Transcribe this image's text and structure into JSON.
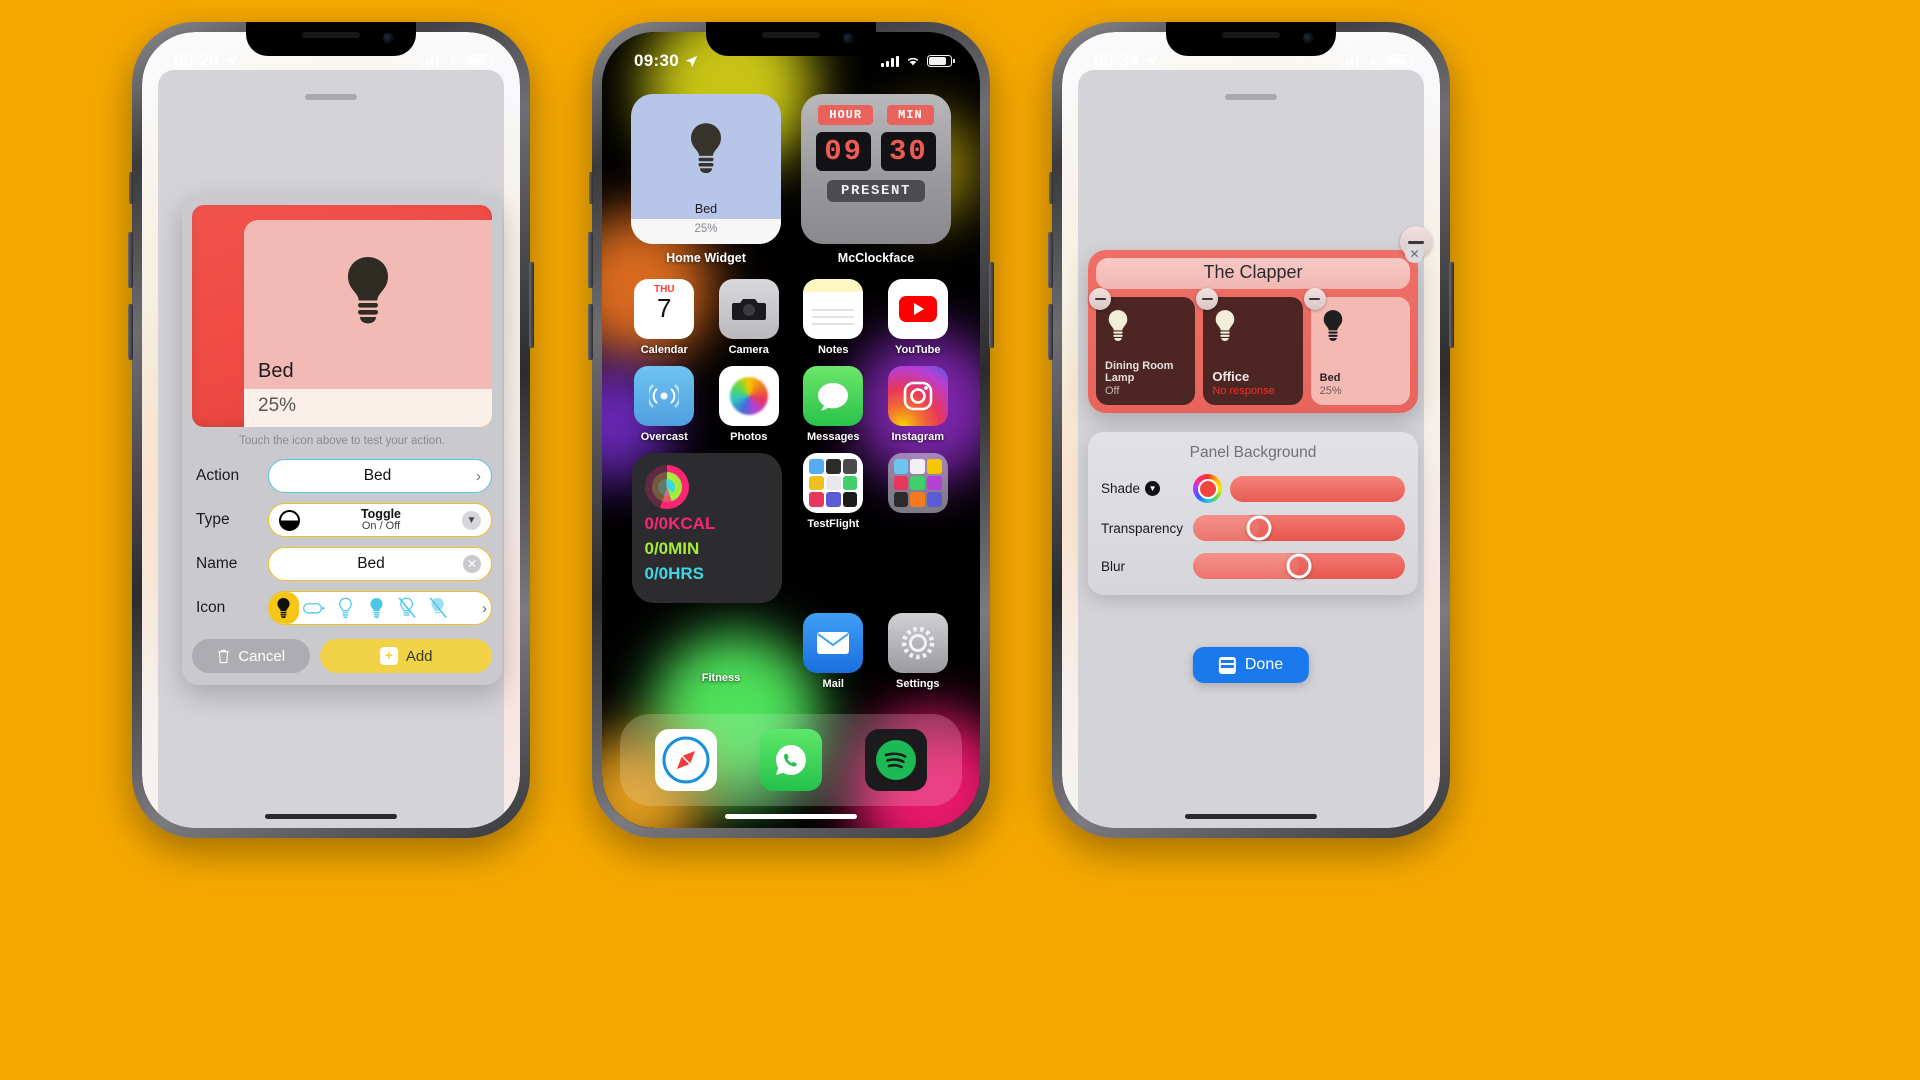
{
  "background_color": "#F5A800",
  "phones": {
    "phone1": {
      "status": {
        "time": "09:26",
        "location_icon": "location-arrow-icon"
      },
      "modal": {
        "preview": {
          "name": "Bed",
          "value": "25%",
          "icon": "lightbulb-icon"
        },
        "hint": "Touch the icon above to test your action.",
        "rows": [
          {
            "label": "Action",
            "value": "Bed",
            "accessory": "chevron-right-icon"
          },
          {
            "label": "Type",
            "value_primary": "Toggle",
            "value_secondary": "On / Off",
            "accessory": "chevron-down-icon"
          },
          {
            "label": "Name",
            "value": "Bed",
            "accessory": "clear-icon"
          },
          {
            "label": "Icon",
            "accessory": "chevron-right-icon"
          }
        ],
        "icon_choices": [
          "bulb-filled",
          "bulb-horizontal",
          "bulb-outline",
          "bulb-solid",
          "bulb-slash",
          "bulb-slash-filled"
        ],
        "buttons": {
          "cancel": "Cancel",
          "add": "Add"
        }
      }
    },
    "phone2": {
      "status": {
        "time": "09:30",
        "location_icon": "location-arrow-icon"
      },
      "widgets": [
        {
          "label": "Home Widget",
          "type": "home",
          "name": "Bed",
          "value": "25%",
          "icon": "lightbulb-icon"
        },
        {
          "label": "McClockface",
          "type": "clock",
          "tag_hour": "HOUR",
          "tag_min": "MIN",
          "hour": "09",
          "min": "30",
          "present": "PRESENT"
        }
      ],
      "apps_row1": [
        {
          "name": "Calendar",
          "weekday": "THU",
          "day": "7"
        },
        {
          "name": "Camera"
        },
        {
          "name": "Notes"
        },
        {
          "name": "YouTube"
        }
      ],
      "apps_row2": [
        {
          "name": "Overcast"
        },
        {
          "name": "Photos"
        },
        {
          "name": "Messages"
        },
        {
          "name": "Instagram"
        }
      ],
      "fitness": {
        "name": "Fitness",
        "move": "0/0KCAL",
        "exercise": "0/0MIN",
        "stand": "0/0HRS"
      },
      "apps_row3": [
        {
          "name": "TestFlight"
        },
        {
          "name": ""
        }
      ],
      "apps_row4": [
        {
          "name": "Mail"
        },
        {
          "name": "Settings"
        }
      ],
      "dock": [
        "Safari",
        "WhatsApp",
        "Spotify"
      ]
    },
    "phone3": {
      "status": {
        "time": "09:34",
        "location_icon": "location-arrow-icon"
      },
      "clapper": {
        "title": "The Clapper",
        "cards": [
          {
            "name": "Dining Room Lamp",
            "status": "Off",
            "status_color": "#c8b5b3",
            "theme": "dark"
          },
          {
            "name": "Office",
            "status": "No response",
            "status_color": "#ff2d20",
            "theme": "dark"
          },
          {
            "name": "Bed",
            "status": "25%",
            "status_color": "#6b5a58",
            "theme": "light"
          }
        ],
        "remove_icon": "minus-circle-icon",
        "close_icon": "close-circle-icon"
      },
      "panel_background": {
        "title": "Panel Background",
        "controls": [
          {
            "label": "Shade",
            "type": "color",
            "accessory": "chevron-down-icon",
            "color": "#f2443c"
          },
          {
            "label": "Transparency",
            "type": "slider",
            "position": 31
          },
          {
            "label": "Blur",
            "type": "slider",
            "position": 50
          }
        ]
      },
      "done_button": {
        "label": "Done",
        "color": "#1a7aed",
        "icon": "panel-icon"
      }
    }
  }
}
